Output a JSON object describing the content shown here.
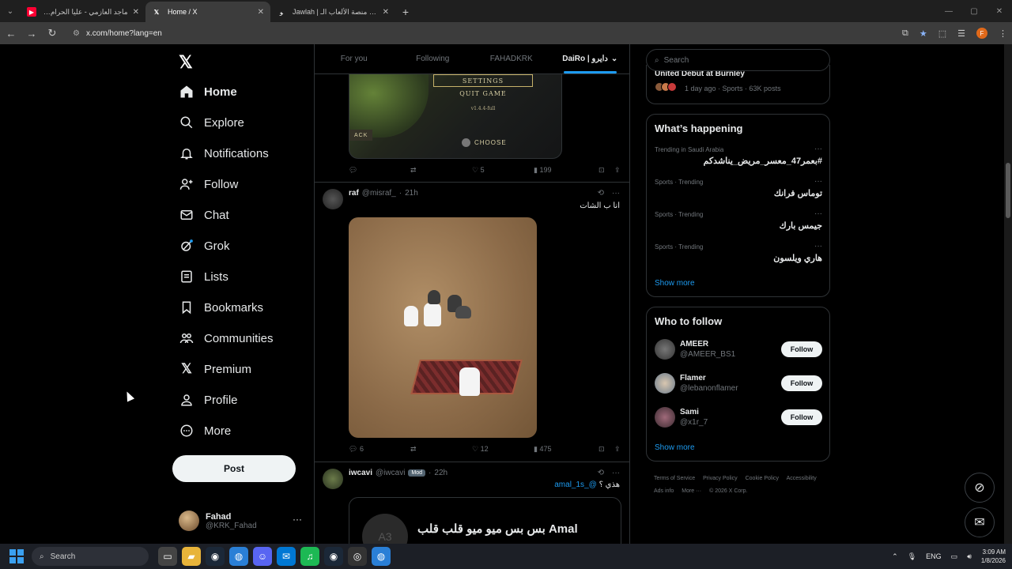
{
  "browser": {
    "tabs": [
      {
        "title": "ماجد العازمي - عليا الحرام ( النسـ",
        "active": false,
        "icon": "youtube-icon",
        "color": "#ff0033"
      },
      {
        "title": "Home / X",
        "active": true,
        "icon": "x-icon",
        "color": "#ffffff"
      },
      {
        "title": "Jawlah | جولة - منصة الألعاب الـ",
        "active": false,
        "icon": "jawlah-icon",
        "color": "#ffffff"
      }
    ],
    "url": "x.com/home?lang=en",
    "profile_initial": "F"
  },
  "nav": {
    "items": [
      {
        "label": "Home",
        "icon": "home-icon"
      },
      {
        "label": "Explore",
        "icon": "search-icon"
      },
      {
        "label": "Notifications",
        "icon": "bell-icon"
      },
      {
        "label": "Follow",
        "icon": "person-plus-icon"
      },
      {
        "label": "Chat",
        "icon": "mail-icon"
      },
      {
        "label": "Grok",
        "icon": "grok-icon"
      },
      {
        "label": "Lists",
        "icon": "list-icon"
      },
      {
        "label": "Bookmarks",
        "icon": "bookmark-icon"
      },
      {
        "label": "Communities",
        "icon": "people-icon"
      },
      {
        "label": "Premium",
        "icon": "x-icon"
      },
      {
        "label": "Profile",
        "icon": "person-icon"
      },
      {
        "label": "More",
        "icon": "more-circle-icon"
      }
    ],
    "post_label": "Post",
    "account": {
      "name": "Fahad",
      "handle": "@KRK_Fahad"
    }
  },
  "feed": {
    "tabs": [
      "For you",
      "Following",
      "FAHADKRK",
      "DaiRo | دايرو"
    ],
    "game": {
      "settings": "SETTINGS",
      "quit": "QUIT GAME",
      "version": "v1.4.4-full",
      "back": "ACK",
      "choose": "CHOOSE"
    },
    "post0_stats": {
      "replies": "",
      "reposts": "",
      "likes": "5",
      "views": "199"
    },
    "post1": {
      "name": "raf",
      "handle": "@misraf_",
      "time": "21h",
      "text": "انا ب الشات",
      "stats": {
        "replies": "6",
        "reposts": "",
        "likes": "12",
        "views": "475"
      }
    },
    "post2": {
      "name": "iwcavi",
      "handle": "@iwcavi",
      "badge": "Mod",
      "time": "22h",
      "text": "هذي ؟",
      "mention": "@_amal_1s",
      "quote_text": "بس بس ميو ميو قلب قلب Amal",
      "quote_avatar": "A3"
    }
  },
  "right": {
    "search_placeholder": "Search",
    "top_trend": {
      "title": "United Debut at Burnley",
      "meta": "1 day ago · Sports · 63K posts"
    },
    "whats_happening": {
      "title": "What’s happening",
      "trends": [
        {
          "category": "Trending in Saudi Arabia",
          "topic": "#بعمر47_معسر_مريض_يناشدكم"
        },
        {
          "category": "Sports · Trending",
          "topic": "توماس فرانك"
        },
        {
          "category": "Sports · Trending",
          "topic": "جيمس بارك"
        },
        {
          "category": "Sports · Trending",
          "topic": "هاري ويلسون"
        }
      ],
      "show_more": "Show more"
    },
    "who_to_follow": {
      "title": "Who to follow",
      "accounts": [
        {
          "name": "AMEER",
          "handle": "@AMEER_BS1",
          "button": "Follow"
        },
        {
          "name": "Flamer",
          "handle": "@lebanonflamer",
          "button": "Follow"
        },
        {
          "name": "Sami",
          "handle": "@x1r_7",
          "button": "Follow"
        }
      ],
      "show_more": "Show more"
    },
    "footer": [
      "Terms of Service",
      "Privacy Policy",
      "Cookie Policy",
      "Accessibility",
      "Ads info",
      "More ···",
      "© 2026 X Corp."
    ]
  },
  "taskbar": {
    "search": "Search",
    "lang": "ENG",
    "time": "3:09 AM",
    "date": "1/8/2026"
  }
}
